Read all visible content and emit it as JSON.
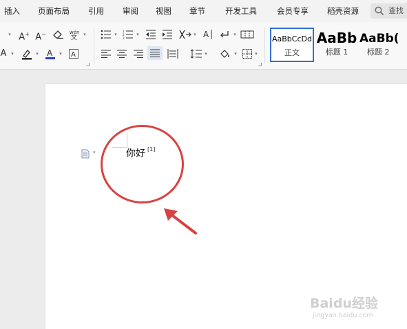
{
  "menubar": {
    "tabs": [
      {
        "label": "插入"
      },
      {
        "label": "页面布局"
      },
      {
        "label": "引用"
      },
      {
        "label": "审阅"
      },
      {
        "label": "视图"
      },
      {
        "label": "章节"
      },
      {
        "label": "开发工具"
      },
      {
        "label": "会员专享"
      },
      {
        "label": "稻壳资源"
      }
    ],
    "search_label": "查找"
  },
  "ribbon": {
    "styles": [
      {
        "sample": "AaBbCcDd",
        "name": "正文",
        "selected": true
      },
      {
        "sample": "AaBb",
        "name": "标题 1",
        "selected": false
      },
      {
        "sample": "AaBb(",
        "name": "标题 2",
        "selected": false
      }
    ],
    "icons": [
      "font-grow-icon",
      "font-shrink-icon",
      "clear-format-icon",
      "phonetic-guide-icon",
      "bullet-list-icon",
      "numbered-list-icon",
      "decrease-indent-icon",
      "increase-indent-icon",
      "chinese-layout-icon",
      "text-direction-icon",
      "show-hide-marks-icon",
      "table-icon",
      "text-effect-icon",
      "highlight-icon",
      "font-color-icon",
      "char-border-icon",
      "align-left-icon",
      "align-center-icon",
      "align-right-icon",
      "justify-icon",
      "distributed-icon",
      "line-spacing-icon",
      "shading-icon",
      "borders-icon"
    ],
    "font_color": "#2b3fd0",
    "highlight_color": "#2b2b2b"
  },
  "document": {
    "text": "你好",
    "footnote_ref": "[1]"
  },
  "annotation": {
    "color": "#d94242"
  },
  "watermark": {
    "logo": "Baidu经验",
    "url": "jingyan.baidu.com"
  }
}
